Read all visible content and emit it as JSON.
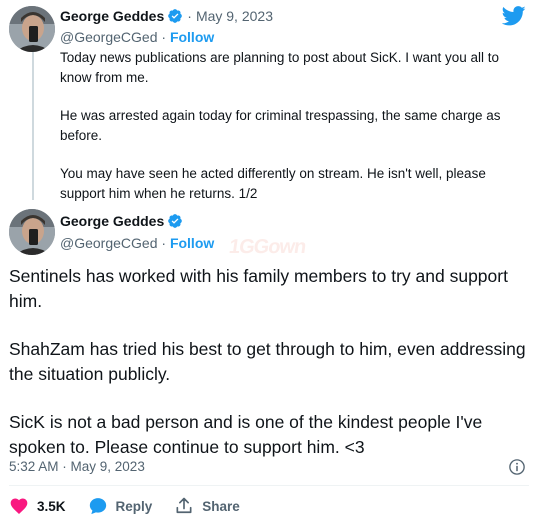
{
  "colors": {
    "twitter_blue": "#1d9bf0",
    "like_red": "#f91880",
    "secondary_text": "#536471",
    "primary_text": "#0f1419"
  },
  "icons": {
    "brand": "twitter-bird-icon",
    "verified": "verified-badge-icon",
    "info": "info-icon",
    "like": "heart-icon",
    "reply": "speech-bubble-icon",
    "share": "share-arrow-icon"
  },
  "tweet1": {
    "author_name": "George Geddes",
    "separator": "·",
    "date": "May 9, 2023",
    "handle": "@GeorgeCGed",
    "handle_sep": " · ",
    "follow_label": "Follow",
    "paragraphs": [
      "Today news publications are planning to post about SicK. I want you all to know from me.",
      "He was arrested again today for criminal trespassing, the same charge as before.",
      "You may have seen he acted differently on stream. He isn't well, please support him when he returns. 1/2"
    ]
  },
  "tweet2": {
    "author_name": "George Geddes",
    "handle": "@GeorgeCGed",
    "handle_sep": " · ",
    "follow_label": "Follow",
    "paragraphs": [
      "Sentinels has worked with his family members to try and support him.",
      "ShahZam has tried his best to get through to him, even addressing the situation publicly.",
      "SicK is not a bad person and is one of the kindest people I've spoken to. Please continue to support him. <3"
    ],
    "timestamp": "5:32 AM · May 9, 2023",
    "like_count": "3.5K",
    "reply_label": "Reply",
    "share_label": "Share"
  },
  "watermark_text": "1GGown"
}
